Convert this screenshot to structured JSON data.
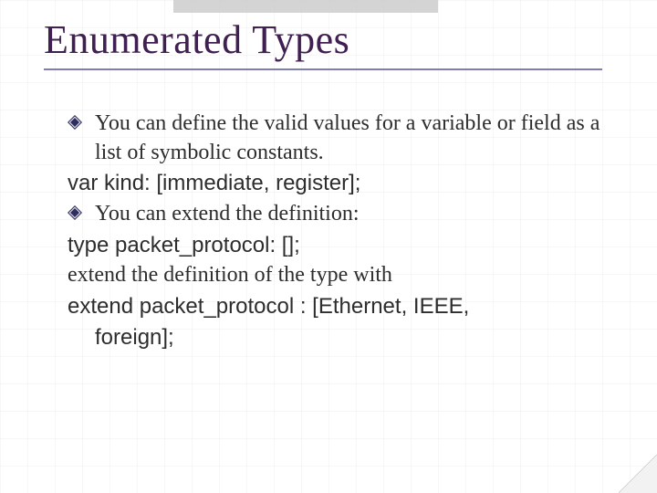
{
  "title": "Enumerated Types",
  "body": {
    "p1": "You can define the valid values for a variable or field as a list of symbolic constants.",
    "p2": "var kind: [immediate, register];",
    "p3": "You can extend the definition:",
    "p4": "type packet_protocol: [];",
    "p5": "extend the definition of the type with",
    "p6a": "extend packet_protocol : [Ethernet, IEEE,",
    "p6b": "foreign];"
  }
}
